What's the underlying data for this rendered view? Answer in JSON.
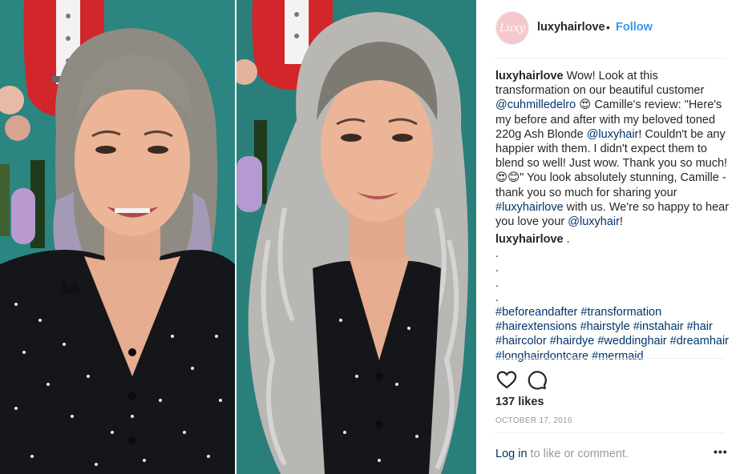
{
  "post": {
    "image_alt": "Before and after hair transformation",
    "header": {
      "username": "luxyhairlove",
      "dot": "•",
      "follow": "Follow",
      "avatar_text": "Luxy"
    },
    "caption": {
      "username": "luxyhairlove",
      "t1": "Wow! Look at this transformation on our beautiful customer",
      "mention1": "@cuhmilledelro",
      "emoji1": "😍",
      "t2": "Camille's review: \"Here's my before and after with my beloved toned 220g Ash Blonde",
      "mention2": "@luxyhair",
      "t3": "! Couldn't be any happier with them. I didn't expect them to blend so well! Just wow. Thank you so much!",
      "emoji2": "😍😊",
      "t4": "\" You look absolutely stunning, Camille - thank you so much for sharing your",
      "hashtag0": "#luxyhairlove",
      "t5": "with us. We're so happy to hear you love your",
      "mention3": "@luxyhair",
      "t6": "!"
    },
    "comment": {
      "username": "luxyhairlove",
      "suffix": ".",
      "dots": [
        ".",
        ".",
        ".",
        "."
      ],
      "hashtags": [
        "#beforeandafter",
        "#transformation",
        "#hairextensions",
        "#hairstyle",
        "#instahair",
        "#hair",
        "#haircolor",
        "#hairdye",
        "#weddinghair",
        "#dreamhair",
        "#longhairdontcare",
        "#mermaid"
      ]
    },
    "icons": {
      "like": "heart-icon",
      "comment": "comment-bubble-icon",
      "more": "more-options-icon"
    },
    "likes": "137 likes",
    "date": "OCTOBER 17, 2016",
    "footer": {
      "login": "Log in",
      "rest": "to like or comment.",
      "more": "•••"
    }
  },
  "colors": {
    "link": "#003569",
    "follow": "#3897f0",
    "muted": "#999999",
    "text": "#262626",
    "backdrop": "#2a7f7b"
  }
}
